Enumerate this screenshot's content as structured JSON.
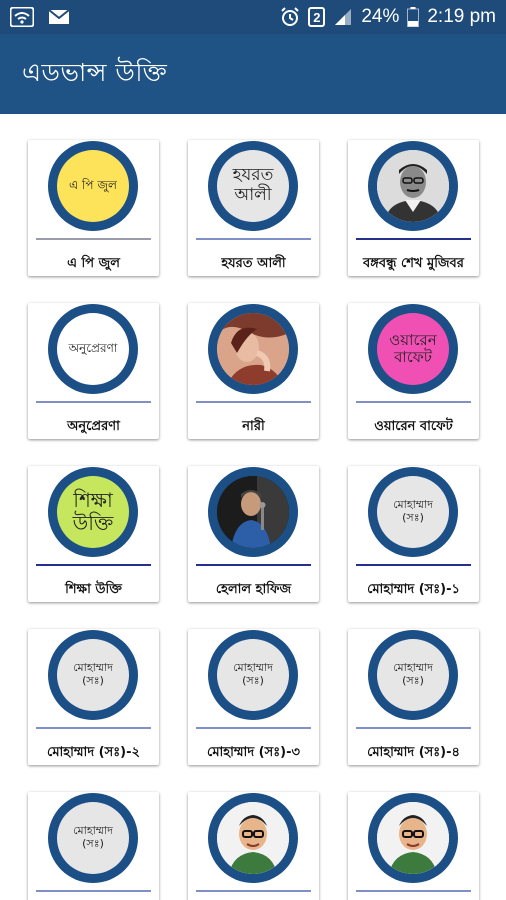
{
  "status_bar": {
    "battery": "24%",
    "time": "2:19 pm",
    "sim_slot": "2",
    "icons": [
      "wifi-icon",
      "mail-icon",
      "alarm-icon",
      "sim-icon",
      "signal-icon",
      "battery-icon"
    ]
  },
  "app_bar": {
    "title": "এডভান্স উক্তি"
  },
  "grid": {
    "cards": [
      {
        "label": "এ পি জুল",
        "thumb": "এ পি জুল"
      },
      {
        "label": "হযরত আলী",
        "thumb": "হযরত আলী"
      },
      {
        "label": "বঙ্গবন্ধু শেখ মুজিবর",
        "thumb": "portrait"
      },
      {
        "label": "অনুপ্রেরণা",
        "thumb": "অনুপ্রেরণা"
      },
      {
        "label": "নারী",
        "thumb": "portrait"
      },
      {
        "label": "ওয়ারেন বাফেট",
        "thumb": "ওয়ারেন বাফেট"
      },
      {
        "label": "শিক্ষা উক্তি",
        "thumb": "শিক্ষা উক্তি"
      },
      {
        "label": "হেলাল হাফিজ",
        "thumb": "portrait"
      },
      {
        "label": "মোহাম্মাদ (সঃ)-১",
        "thumb": "মোহাম্মাদ (সঃ)"
      },
      {
        "label": "মোহাম্মাদ (সঃ)-২",
        "thumb": "মোহাম্মাদ (সঃ)"
      },
      {
        "label": "মোহাম্মাদ (সঃ)-৩",
        "thumb": "মোহাম্মাদ (সঃ)"
      },
      {
        "label": "মোহাম্মাদ (সঃ)-৪",
        "thumb": "মোহাম্মাদ (সঃ)"
      },
      {
        "label": "",
        "thumb": "মোহাম্মাদ (সঃ)"
      },
      {
        "label": "",
        "thumb": "portrait"
      },
      {
        "label": "",
        "thumb": "portrait"
      }
    ]
  },
  "colors": {
    "status_bar": "#1e4b7a",
    "app_bar": "#1f5386",
    "ring": "#1b4f86",
    "thumb_yellow": "#fde35a",
    "thumb_pink": "#f04fb3",
    "thumb_green": "#c5e65d",
    "thumb_gray": "#e6e6e6"
  }
}
